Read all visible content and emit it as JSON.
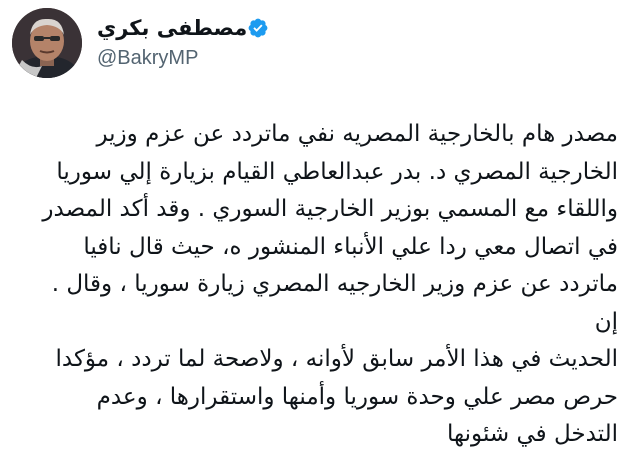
{
  "author": {
    "display_name": "مصطفى بكري",
    "handle": "@BakryMP",
    "verified": true,
    "verified_color": "#1d9bf0"
  },
  "tweet": {
    "text": "مصدر هام بالخارجية المصريه نفي ماتردد عن عزم وزير\nالخارجية المصري د. بدر عبدالعاطي القيام بزيارة إلي سوريا\nواللقاء مع المسمي بوزير الخارجية السوري . وقد أكد المصدر\nفي اتصال معي ردا علي الأنباء المنشور ه، حيث قال نافيا\nماتردد عن عزم وزير الخارجيه المصري زيارة سوريا ، وقال . إن\nالحديث في هذا الأمر سابق لأوانه ، ولاصحة لما تردد ، مؤكدا\nحرص مصر علي وحدة سوريا وأمنها واستقرارها ، وعدم\nالتدخل في شئونها"
  }
}
